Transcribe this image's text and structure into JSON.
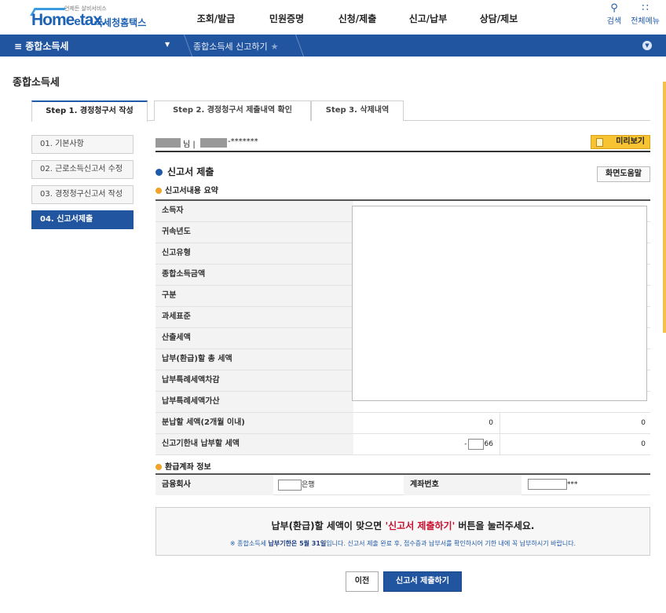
{
  "header": {
    "logo_small": "언제든 살비서비스",
    "logo_home": "Home",
    "logo_e": "e",
    "logo_tax": "tax.",
    "logo_korean": "국세청홈택스",
    "nav": [
      "조회/발급",
      "민원증명",
      "신청/제출",
      "신고/납부",
      "상담/제보"
    ],
    "search_label": "검색",
    "all_menu_label": "전체메뉴"
  },
  "bluebar": {
    "menu_label": "≡ 종합소득세",
    "crumb": "종합소득세 신고하기"
  },
  "page_title": "종합소득세",
  "tabs": [
    "Step 1. 경정청구서 작성",
    "Step 2. 경정청구서 제출내역 확인",
    "Step 3. 삭제내역"
  ],
  "steps": [
    "01. 기본사항",
    "02. 근로소득신고서 수정",
    "03. 경정청구신고서 작성",
    "04. 신고서제출"
  ],
  "user": {
    "name_suffix": "님 |",
    "id_tail": "-*******"
  },
  "preview_label": "미리보기",
  "section_title": "신고서 제출",
  "help_label": "화면도움말",
  "summary_title": "신고서내용 요약",
  "summary_rows": [
    "소득자",
    "귀속년도",
    "신고유형",
    "종합소득금액",
    "구분",
    "과세표준",
    "산출세액",
    "납부(환급)할 총 세액",
    "납부특례세액차감",
    "납부특례세액가산"
  ],
  "installment_row": {
    "label": "분납할 세액(2개월 이내)",
    "v1": "0",
    "v2": "0"
  },
  "due_row": {
    "label": "신고기한내 납부할 세액",
    "prefix": "-",
    "suffix": "66",
    "v2": "0"
  },
  "refund": {
    "title": "환급계좌 정보",
    "bank_label": "금융회사",
    "bank_suffix": "은행",
    "account_label": "계좌번호",
    "account_suffix": "***"
  },
  "notice": {
    "main_pre": "납부(환급)할 세액이 맞으면 ",
    "main_red": "'신고서 제출하기'",
    "main_post": " 버튼을 눌러주세요.",
    "sub_pre": "※ 종합소득세 ",
    "sub_bold": "납부기한은 5월 31일",
    "sub_post": "입니다. 신고서 제출 완료 후, 접수증과 납부서를 확인하시어 기한 내에 꼭 납부하시기 바랍니다."
  },
  "buttons": {
    "prev": "이전",
    "submit": "신고서 제출하기"
  },
  "colors": {
    "primary": "#2255a0",
    "accent": "#f7c332",
    "alert": "#c8102e"
  }
}
